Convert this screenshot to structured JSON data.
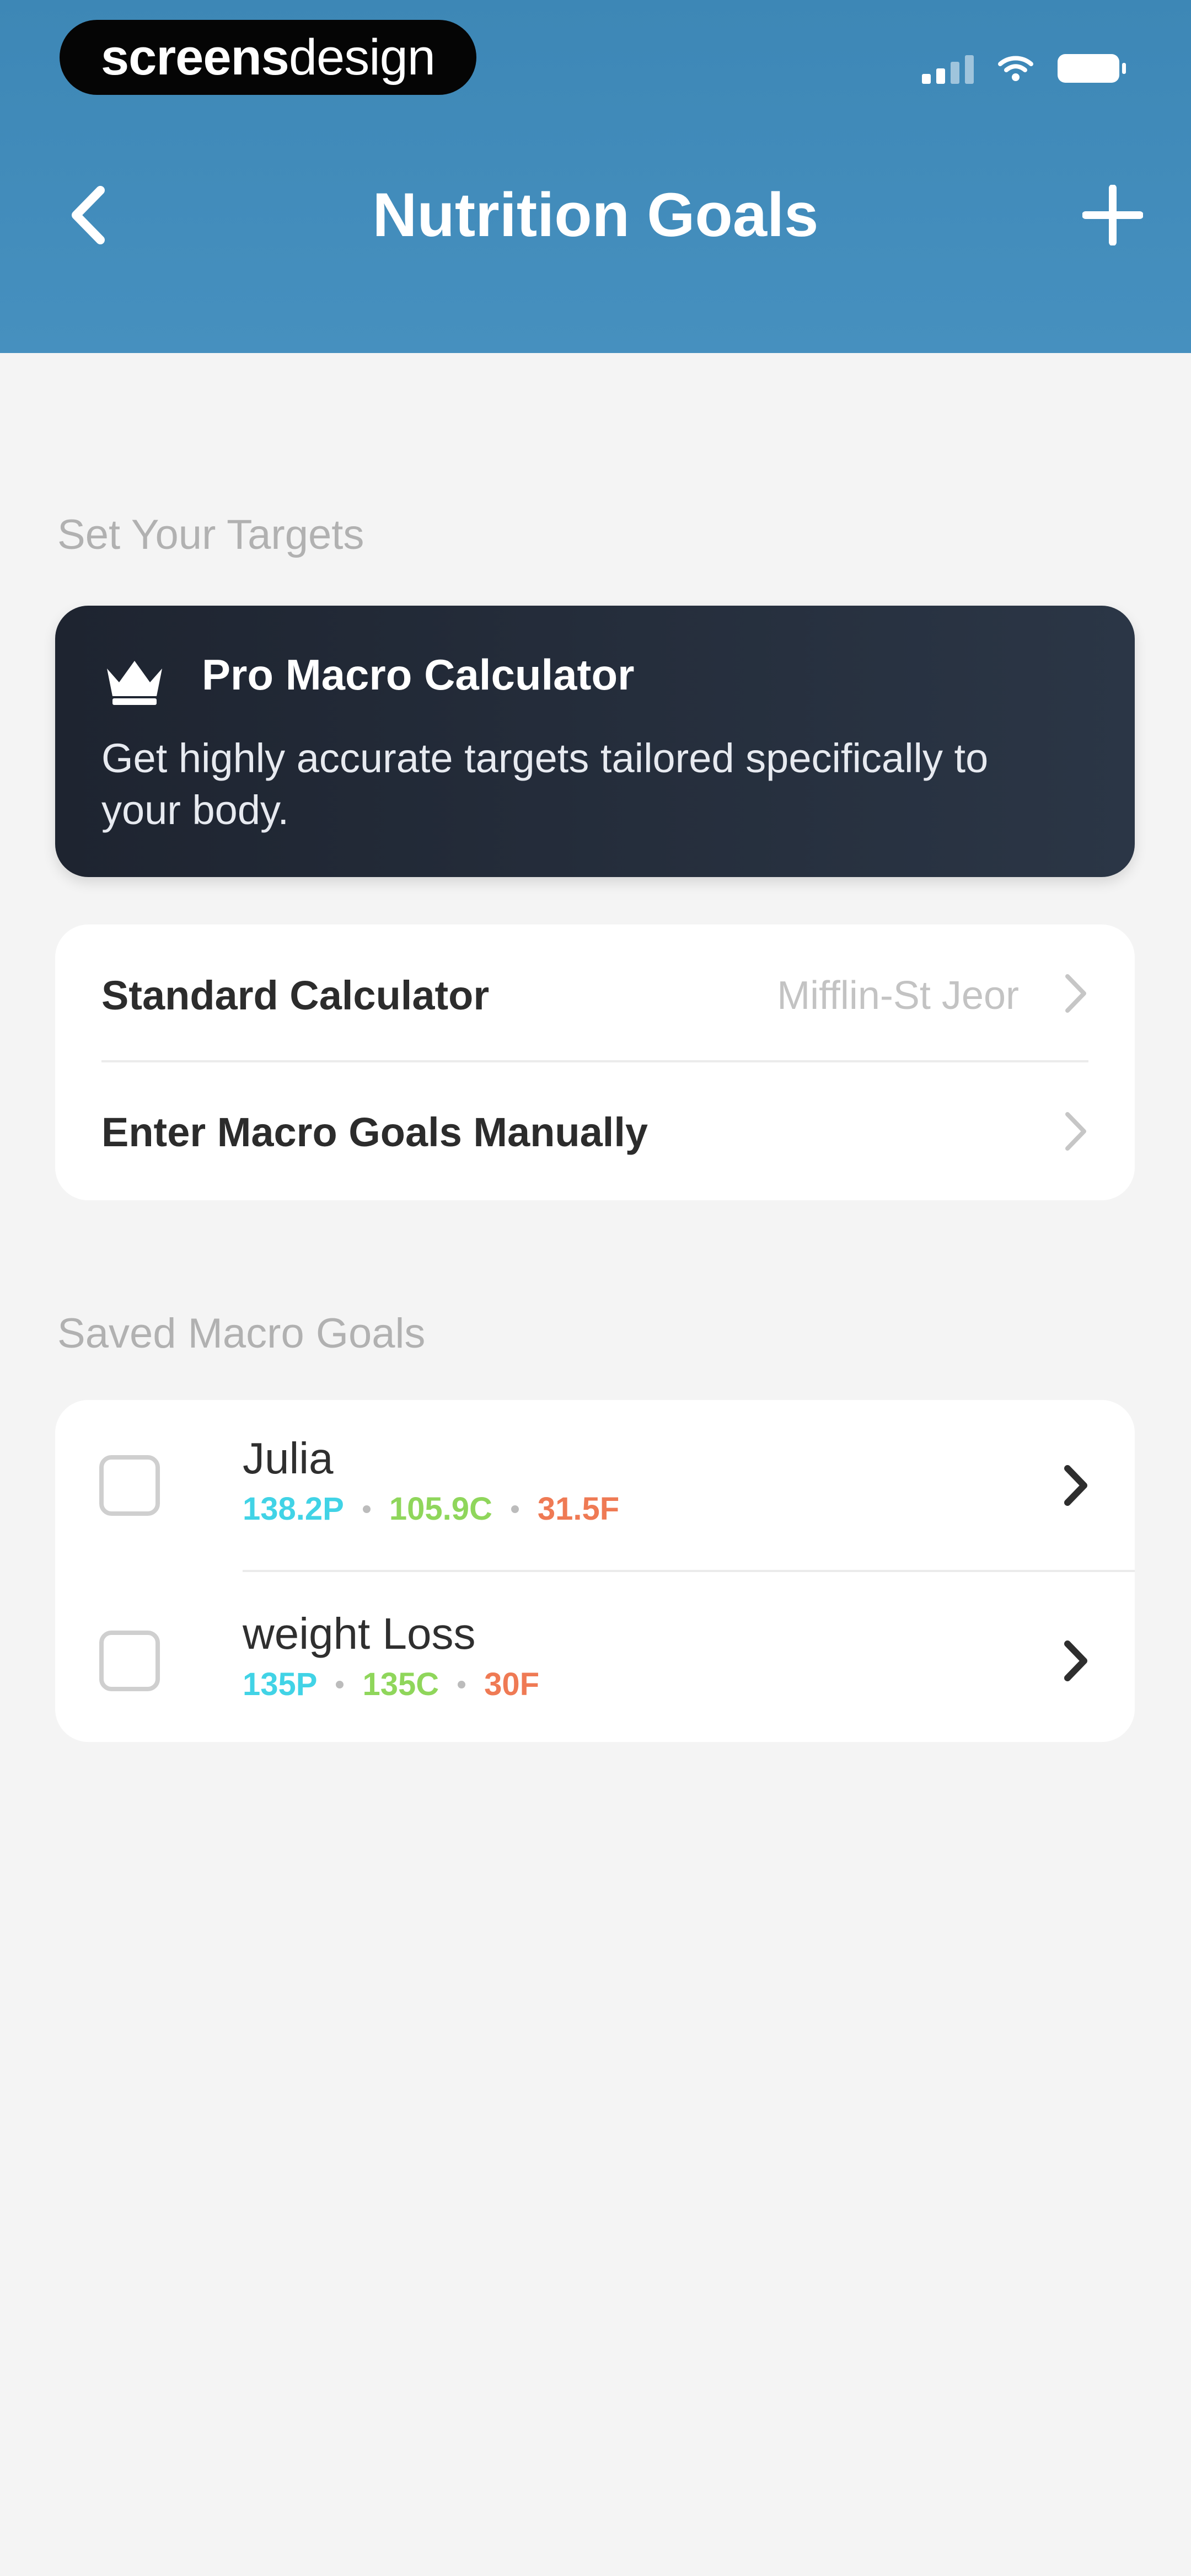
{
  "brand": {
    "part1": "screens",
    "part2": "design"
  },
  "header": {
    "title": "Nutrition Goals",
    "back_icon": "chevron-left-icon",
    "add_icon": "plus-icon"
  },
  "colors": {
    "header": "#4690bf",
    "protein": "#41d3e6",
    "carbs": "#8fd65b",
    "fat": "#ef7a54",
    "pro_card": "#252e3b"
  },
  "targets": {
    "section_label": "Set Your Targets",
    "pro": {
      "title": "Pro Macro Calculator",
      "description": "Get highly accurate targets tailored specifically to your body.",
      "icon": "crown-icon"
    },
    "options": [
      {
        "label": "Standard Calculator",
        "value": "Mifflin-St Jeor"
      },
      {
        "label": "Enter Macro Goals Manually",
        "value": ""
      }
    ]
  },
  "saved": {
    "section_label": "Saved Macro Goals",
    "goals": [
      {
        "name": "Julia",
        "protein": "138.2P",
        "carbs": "105.9C",
        "fat": "31.5F"
      },
      {
        "name": "weight Loss",
        "protein": "135P",
        "carbs": "135C",
        "fat": "30F"
      }
    ]
  }
}
